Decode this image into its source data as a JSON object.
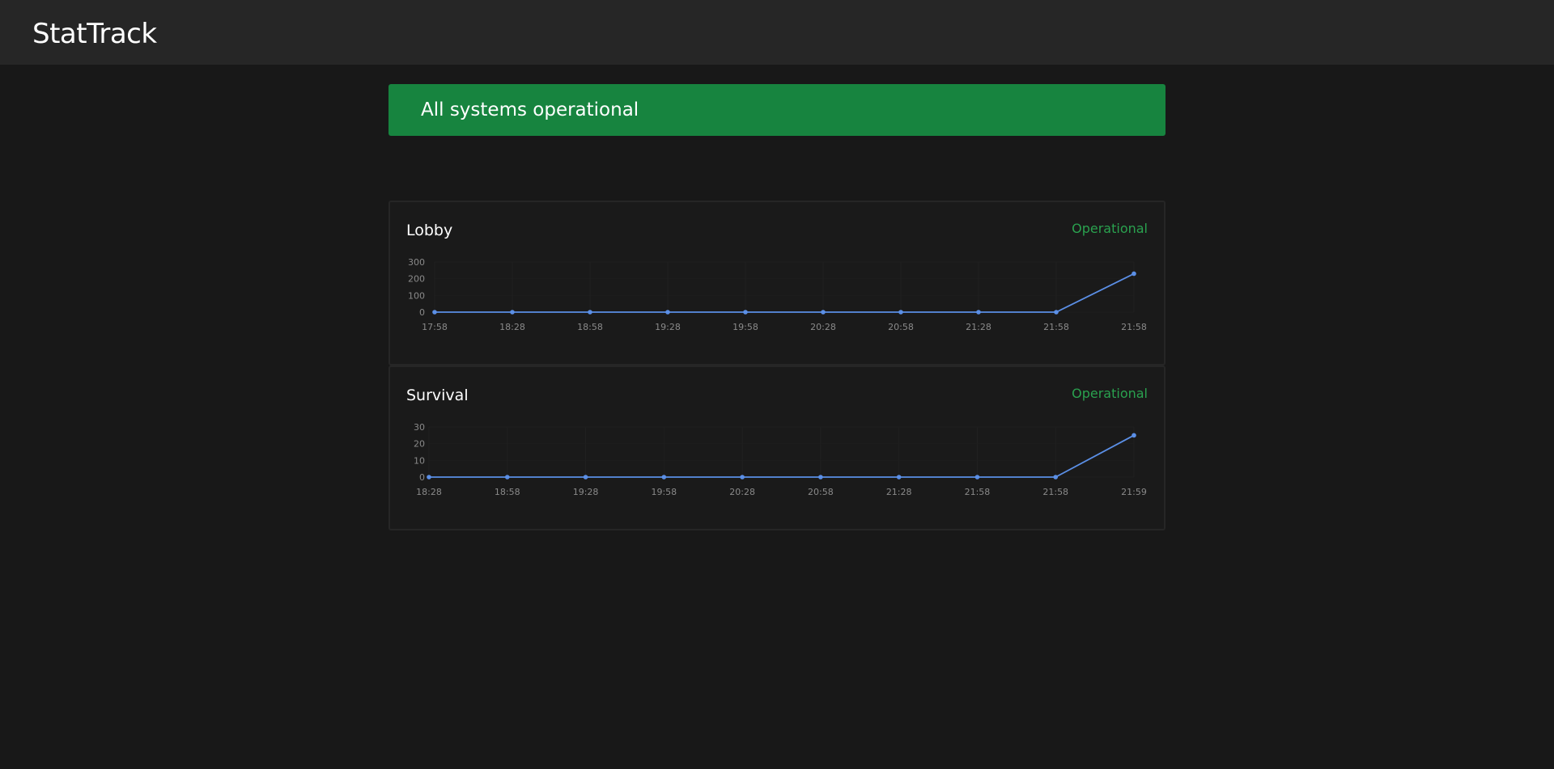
{
  "app": {
    "title": "StatTrack"
  },
  "banner": {
    "text": "All systems operational",
    "color": "#17843f"
  },
  "colors": {
    "line": "#5b8fe6",
    "operational": "#2aa14f"
  },
  "servers": [
    {
      "name": "Lobby",
      "status": "Operational",
      "chart_data": {
        "type": "line",
        "x": [
          "17:58",
          "18:28",
          "18:58",
          "19:28",
          "19:58",
          "20:28",
          "20:58",
          "21:28",
          "21:58",
          "21:58"
        ],
        "values": [
          0,
          0,
          0,
          0,
          0,
          0,
          0,
          0,
          0,
          230
        ],
        "y_ticks": [
          "300",
          "200",
          "100",
          "0"
        ],
        "ylim": [
          0,
          300
        ],
        "grid": true
      }
    },
    {
      "name": "Survival",
      "status": "Operational",
      "chart_data": {
        "type": "line",
        "x": [
          "18:28",
          "18:58",
          "19:28",
          "19:58",
          "20:28",
          "20:58",
          "21:28",
          "21:58",
          "21:58",
          "21:59"
        ],
        "values": [
          0,
          0,
          0,
          0,
          0,
          0,
          0,
          0,
          0,
          25
        ],
        "y_ticks": [
          "30",
          "20",
          "10",
          "0"
        ],
        "ylim": [
          0,
          30
        ],
        "grid": true
      }
    }
  ]
}
